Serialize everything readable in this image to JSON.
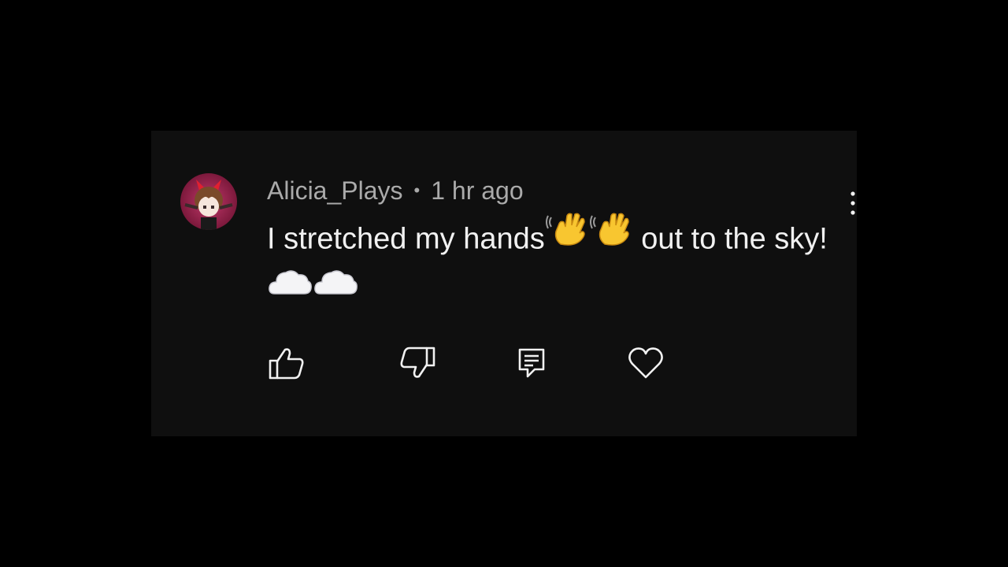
{
  "comment": {
    "author": "Alicia_Plays",
    "separator": "•",
    "timestamp": "1 hr ago",
    "text_part1": "I stretched my hands",
    "text_part2": " out to the sky!",
    "emojis": {
      "wave_1": "waving-hand-emoji",
      "wave_2": "waving-hand-emoji",
      "cloud_1": "cloud-emoji",
      "cloud_2": "cloud-emoji"
    }
  },
  "actions": {
    "like": "thumbs-up-icon",
    "dislike": "thumbs-down-icon",
    "reply": "reply-comment-icon",
    "heart": "heart-icon"
  },
  "colors": {
    "background": "#000000",
    "card": "#0f0f0f",
    "meta_text": "#aaaaaa",
    "body_text": "#f1f1f1",
    "icon": "#f1f1f1",
    "avatar_bg": "#a0204a"
  }
}
